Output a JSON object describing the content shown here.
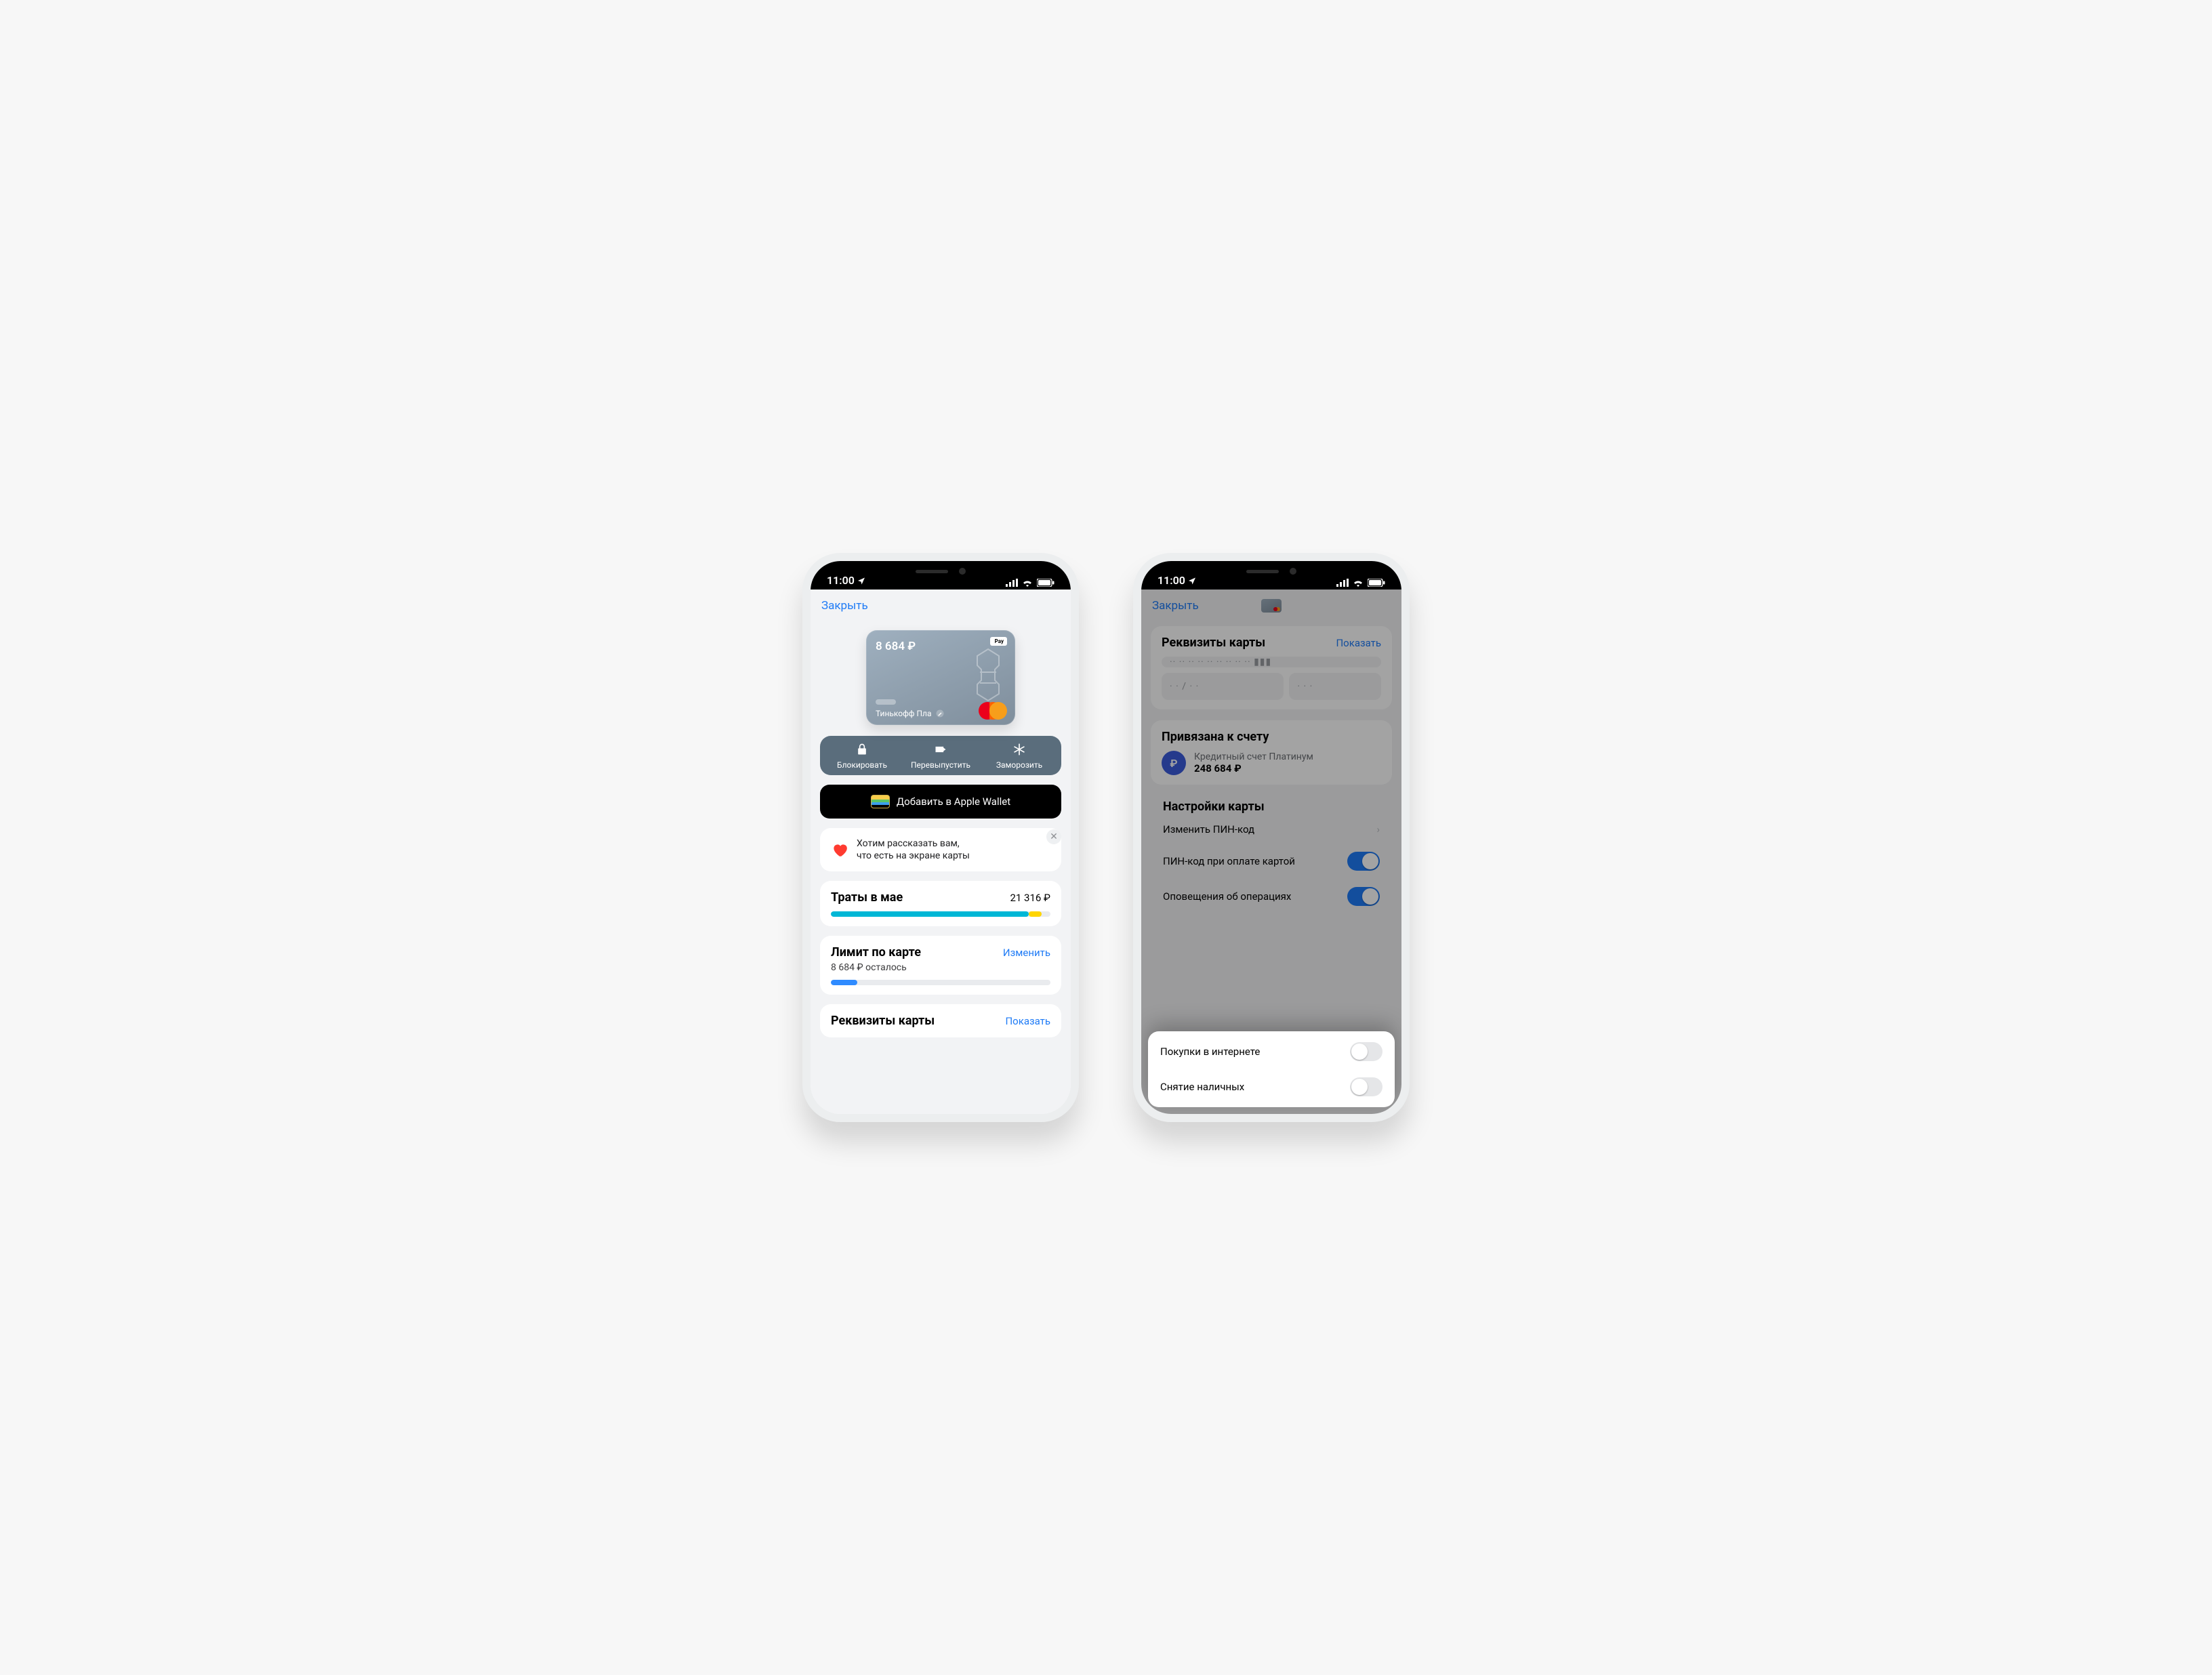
{
  "status": {
    "time": "11:00"
  },
  "common": {
    "close_label": "Закрыть"
  },
  "screen1": {
    "card": {
      "balance": "8 684 ₽",
      "apple_pay": "Pay",
      "product_name": "Тинькофф Пла"
    },
    "actions": {
      "block": "Блокировать",
      "reissue": "Перевыпустить",
      "freeze": "Заморозить"
    },
    "wallet_button": "Добавить в Apple Wallet",
    "tip": {
      "line1": "Хотим рассказать вам,",
      "line2": "что есть на экране карты"
    },
    "spend": {
      "title": "Траты в мае",
      "value": "21 316 ₽",
      "progress_main_pct": 90,
      "progress_tail_pct": 6
    },
    "limit": {
      "title": "Лимит по карте",
      "change": "Изменить",
      "remaining": "8 684 ₽ осталось",
      "progress_pct": 12
    },
    "requisites_peek": {
      "title": "Реквизиты карты",
      "show": "Показать"
    }
  },
  "screen2": {
    "requisites": {
      "title": "Реквизиты карты",
      "show": "Показать",
      "pan_mask": "·· ·· ··   ·· ·· ··   ·· ·· ··   ▮▮▮",
      "exp_mask": "· ·  /  · ·",
      "cvc_mask": "· · ·"
    },
    "linked": {
      "title": "Привязана к счету",
      "badge": "₽",
      "name": "Кредитный счет Платинум",
      "value": "248 684 ₽"
    },
    "settings": {
      "title": "Настройки карты",
      "items": {
        "change_pin": "Изменить ПИН-код",
        "pin_on_pay": "ПИН-код при оплате картой",
        "op_notifications": "Оповещения об операциях",
        "online_purchases": "Покупки в интернете",
        "cash_withdraw": "Снятие наличных"
      },
      "toggles": {
        "pin_on_pay": true,
        "op_notifications": true,
        "online_purchases": false,
        "cash_withdraw": false
      }
    }
  }
}
